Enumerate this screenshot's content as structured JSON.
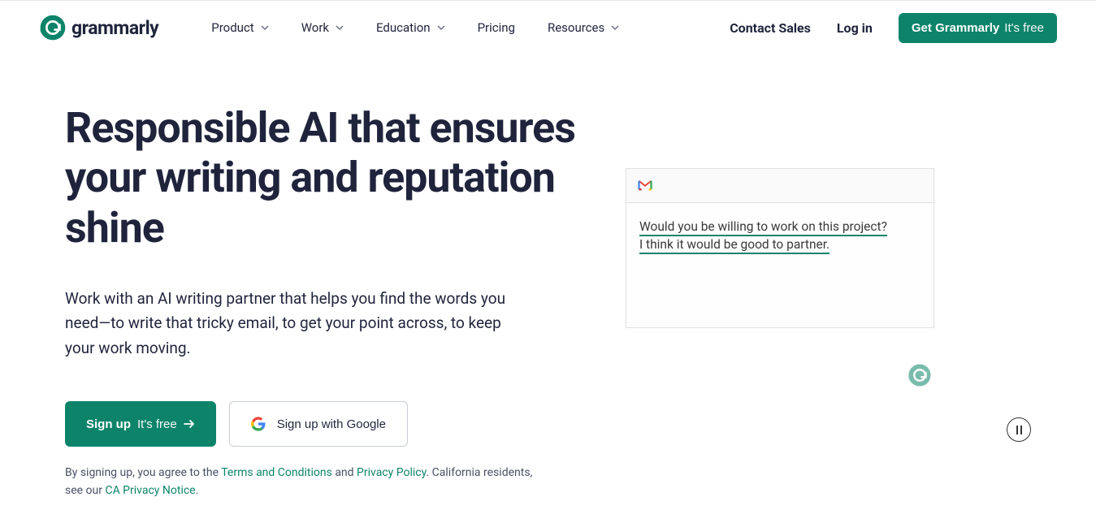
{
  "brand": {
    "name": "grammarly"
  },
  "nav": {
    "items": [
      {
        "label": "Product",
        "hasDropdown": true
      },
      {
        "label": "Work",
        "hasDropdown": true
      },
      {
        "label": "Education",
        "hasDropdown": true
      },
      {
        "label": "Pricing",
        "hasDropdown": false
      },
      {
        "label": "Resources",
        "hasDropdown": true
      }
    ]
  },
  "header": {
    "contact": "Contact Sales",
    "login": "Log in",
    "cta_main": "Get Grammarly",
    "cta_sub": "It's free"
  },
  "hero": {
    "title": "Responsible AI that ensures your writing and reputation shine",
    "subtitle": "Work with an AI writing partner that helps you find the words you need—to write that tricky email, to get your point across, to keep your work moving.",
    "signup_main": "Sign up",
    "signup_sub": "It's free",
    "google_button": "Sign up with Google"
  },
  "legal": {
    "prefix": "By signing up, you agree to the ",
    "terms_link": "Terms and Conditions",
    "and": " and ",
    "privacy_link": "Privacy Policy",
    "ca_prefix": ". California residents, see our ",
    "ca_link": "CA Privacy Notice",
    "suffix": "."
  },
  "email_demo": {
    "line1": "Would you be willing to work on this project?",
    "line2": "I think it would be good to partner."
  },
  "colors": {
    "brand_green": "#0d846a",
    "text_dark": "#1f243c"
  }
}
